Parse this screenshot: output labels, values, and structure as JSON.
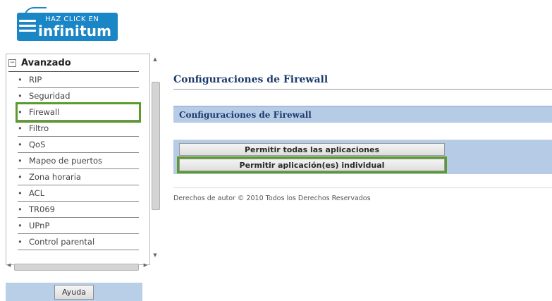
{
  "logo": {
    "line1": "HAZ CLICK EN",
    "line2": "infinitum",
    "brand_color": "#1a86c6"
  },
  "sidebar": {
    "section_toggle": "−",
    "section_title": "Avanzado",
    "bullet": "•",
    "items": [
      {
        "label": "RIP"
      },
      {
        "label": "Seguridad"
      },
      {
        "label": "Firewall"
      },
      {
        "label": "Filtro"
      },
      {
        "label": "QoS"
      },
      {
        "label": "Mapeo de puertos"
      },
      {
        "label": "Zona horaria"
      },
      {
        "label": "ACL"
      },
      {
        "label": "TR069"
      },
      {
        "label": "UPnP"
      },
      {
        "label": "Control parental"
      }
    ],
    "highlighted_item": "Firewall",
    "highlight_color": "#5a9b2a"
  },
  "help": {
    "label": "Ayuda"
  },
  "main": {
    "page_title": "Configuraciones de Firewall",
    "panel_title": "Configuraciones de Firewall",
    "buttons": {
      "allow_all": "Permitir todas las aplicaciones",
      "allow_individual": "Permitir aplicación(es) individual"
    },
    "copyright": "Derechos de autor © 2010 Todos los Derechos Reservados",
    "panel_color": "#b6cbe6"
  }
}
